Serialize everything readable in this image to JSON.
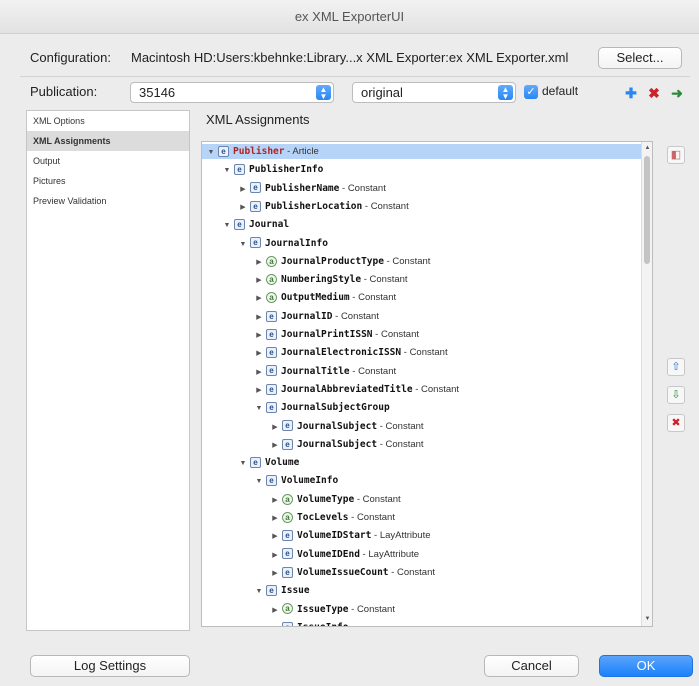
{
  "window": {
    "title": "ex XML ExporterUI"
  },
  "config": {
    "label": "Configuration:",
    "path": "Macintosh HD:Users:kbehnke:Library...x XML Exporter:ex XML Exporter.xml",
    "select_label": "Select..."
  },
  "publication": {
    "label": "Publication:",
    "id_value": "35146",
    "variant_value": "original",
    "default_label": "default",
    "default_checked": true
  },
  "toolbar": {
    "icons": [
      "add-icon",
      "delete-icon",
      "export-icon"
    ],
    "colors": {
      "add": "#2a86f3",
      "delete": "#d0202a",
      "export": "#2e8b3e"
    }
  },
  "sidebar": {
    "items": [
      {
        "label": "XML Options"
      },
      {
        "label": "XML Assignments",
        "active": true
      },
      {
        "label": "Output"
      },
      {
        "label": "Pictures"
      },
      {
        "label": "Preview Validation"
      }
    ]
  },
  "main": {
    "title": "XML Assignments",
    "tree": [
      {
        "depth": 0,
        "open": true,
        "kind": "e",
        "name": "Publisher",
        "type": "Article",
        "selected": true,
        "red": true
      },
      {
        "depth": 1,
        "open": true,
        "kind": "e",
        "name": "PublisherInfo",
        "type": ""
      },
      {
        "depth": 2,
        "open": false,
        "kind": "e",
        "name": "PublisherName",
        "type": "Constant"
      },
      {
        "depth": 2,
        "open": false,
        "kind": "e",
        "name": "PublisherLocation",
        "type": "Constant"
      },
      {
        "depth": 1,
        "open": true,
        "kind": "e",
        "name": "Journal",
        "type": ""
      },
      {
        "depth": 2,
        "open": true,
        "kind": "e",
        "name": "JournalInfo",
        "type": ""
      },
      {
        "depth": 3,
        "open": false,
        "kind": "a",
        "name": "JournalProductType",
        "type": "Constant"
      },
      {
        "depth": 3,
        "open": false,
        "kind": "a",
        "name": "NumberingStyle",
        "type": "Constant"
      },
      {
        "depth": 3,
        "open": false,
        "kind": "a",
        "name": "OutputMedium",
        "type": "Constant"
      },
      {
        "depth": 3,
        "open": false,
        "kind": "e",
        "name": "JournalID",
        "type": "Constant"
      },
      {
        "depth": 3,
        "open": false,
        "kind": "e",
        "name": "JournalPrintISSN",
        "type": "Constant"
      },
      {
        "depth": 3,
        "open": false,
        "kind": "e",
        "name": "JournalElectronicISSN",
        "type": "Constant"
      },
      {
        "depth": 3,
        "open": false,
        "kind": "e",
        "name": "JournalTitle",
        "type": "Constant"
      },
      {
        "depth": 3,
        "open": false,
        "kind": "e",
        "name": "JournalAbbreviatedTitle",
        "type": "Constant"
      },
      {
        "depth": 3,
        "open": true,
        "kind": "e",
        "name": "JournalSubjectGroup",
        "type": ""
      },
      {
        "depth": 4,
        "open": false,
        "kind": "e",
        "name": "JournalSubject",
        "type": "Constant"
      },
      {
        "depth": 4,
        "open": false,
        "kind": "e",
        "name": "JournalSubject",
        "type": "Constant"
      },
      {
        "depth": 2,
        "open": true,
        "kind": "e",
        "name": "Volume",
        "type": ""
      },
      {
        "depth": 3,
        "open": true,
        "kind": "e",
        "name": "VolumeInfo",
        "type": ""
      },
      {
        "depth": 4,
        "open": false,
        "kind": "a",
        "name": "VolumeType",
        "type": "Constant"
      },
      {
        "depth": 4,
        "open": false,
        "kind": "a",
        "name": "TocLevels",
        "type": "Constant"
      },
      {
        "depth": 4,
        "open": false,
        "kind": "e",
        "name": "VolumeIDStart",
        "type": "LayAttribute"
      },
      {
        "depth": 4,
        "open": false,
        "kind": "e",
        "name": "VolumeIDEnd",
        "type": "LayAttribute"
      },
      {
        "depth": 4,
        "open": false,
        "kind": "e",
        "name": "VolumeIssueCount",
        "type": "Constant"
      },
      {
        "depth": 3,
        "open": true,
        "kind": "e",
        "name": "Issue",
        "type": ""
      },
      {
        "depth": 4,
        "open": false,
        "kind": "a",
        "name": "IssueType",
        "type": "Constant"
      },
      {
        "depth": 4,
        "open": true,
        "kind": "e",
        "name": "IssueInfo",
        "type": ""
      }
    ]
  },
  "side_buttons": [
    "move-up-icon",
    "move-down-icon",
    "remove-icon"
  ],
  "footer": {
    "log_settings_label": "Log Settings",
    "cancel_label": "Cancel",
    "ok_label": "OK"
  }
}
